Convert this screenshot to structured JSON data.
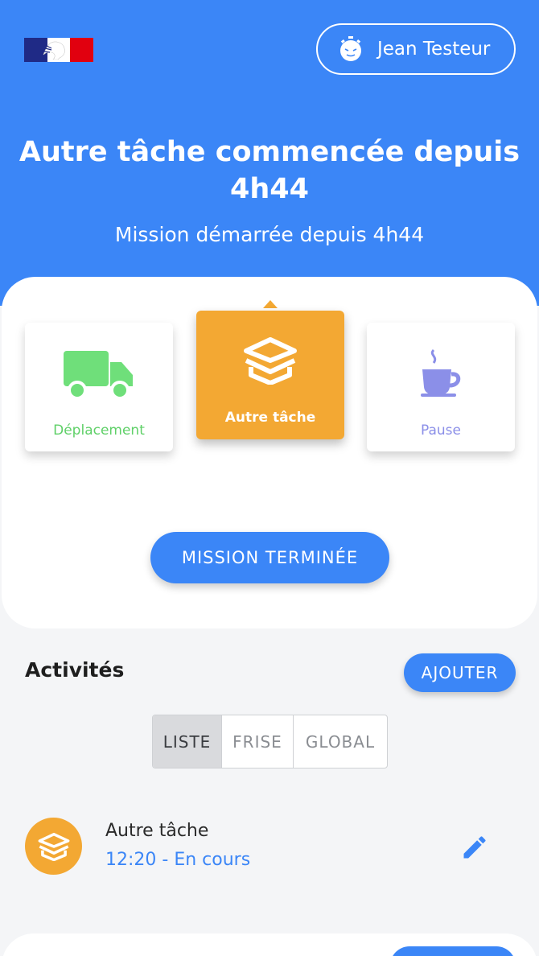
{
  "header": {
    "user_name": "Jean Testeur",
    "title": "Autre tâche commencée depuis 4h44",
    "subtitle": "Mission démarrée depuis 4h44",
    "background_color": "#3b86f7"
  },
  "activities": [
    {
      "label": "Déplacement",
      "icon": "truck-icon",
      "color": "#5fd068",
      "selected": false
    },
    {
      "label": "Autre tâche",
      "icon": "box-icon",
      "color": "#f3a833",
      "selected": true
    },
    {
      "label": "Pause",
      "icon": "coffee-icon",
      "color": "#8b8fe8",
      "selected": false
    }
  ],
  "end_mission_label": "MISSION TERMINÉE",
  "section": {
    "title": "Activités",
    "add_label": "AJOUTER"
  },
  "view_tabs": [
    {
      "label": "LISTE",
      "selected": true
    },
    {
      "label": "FRISE",
      "selected": false
    },
    {
      "label": "GLOBAL",
      "selected": false
    }
  ],
  "activity_list": [
    {
      "title": "Autre tâche",
      "subtitle": "12:20 - En cours",
      "icon": "box-icon"
    }
  ]
}
